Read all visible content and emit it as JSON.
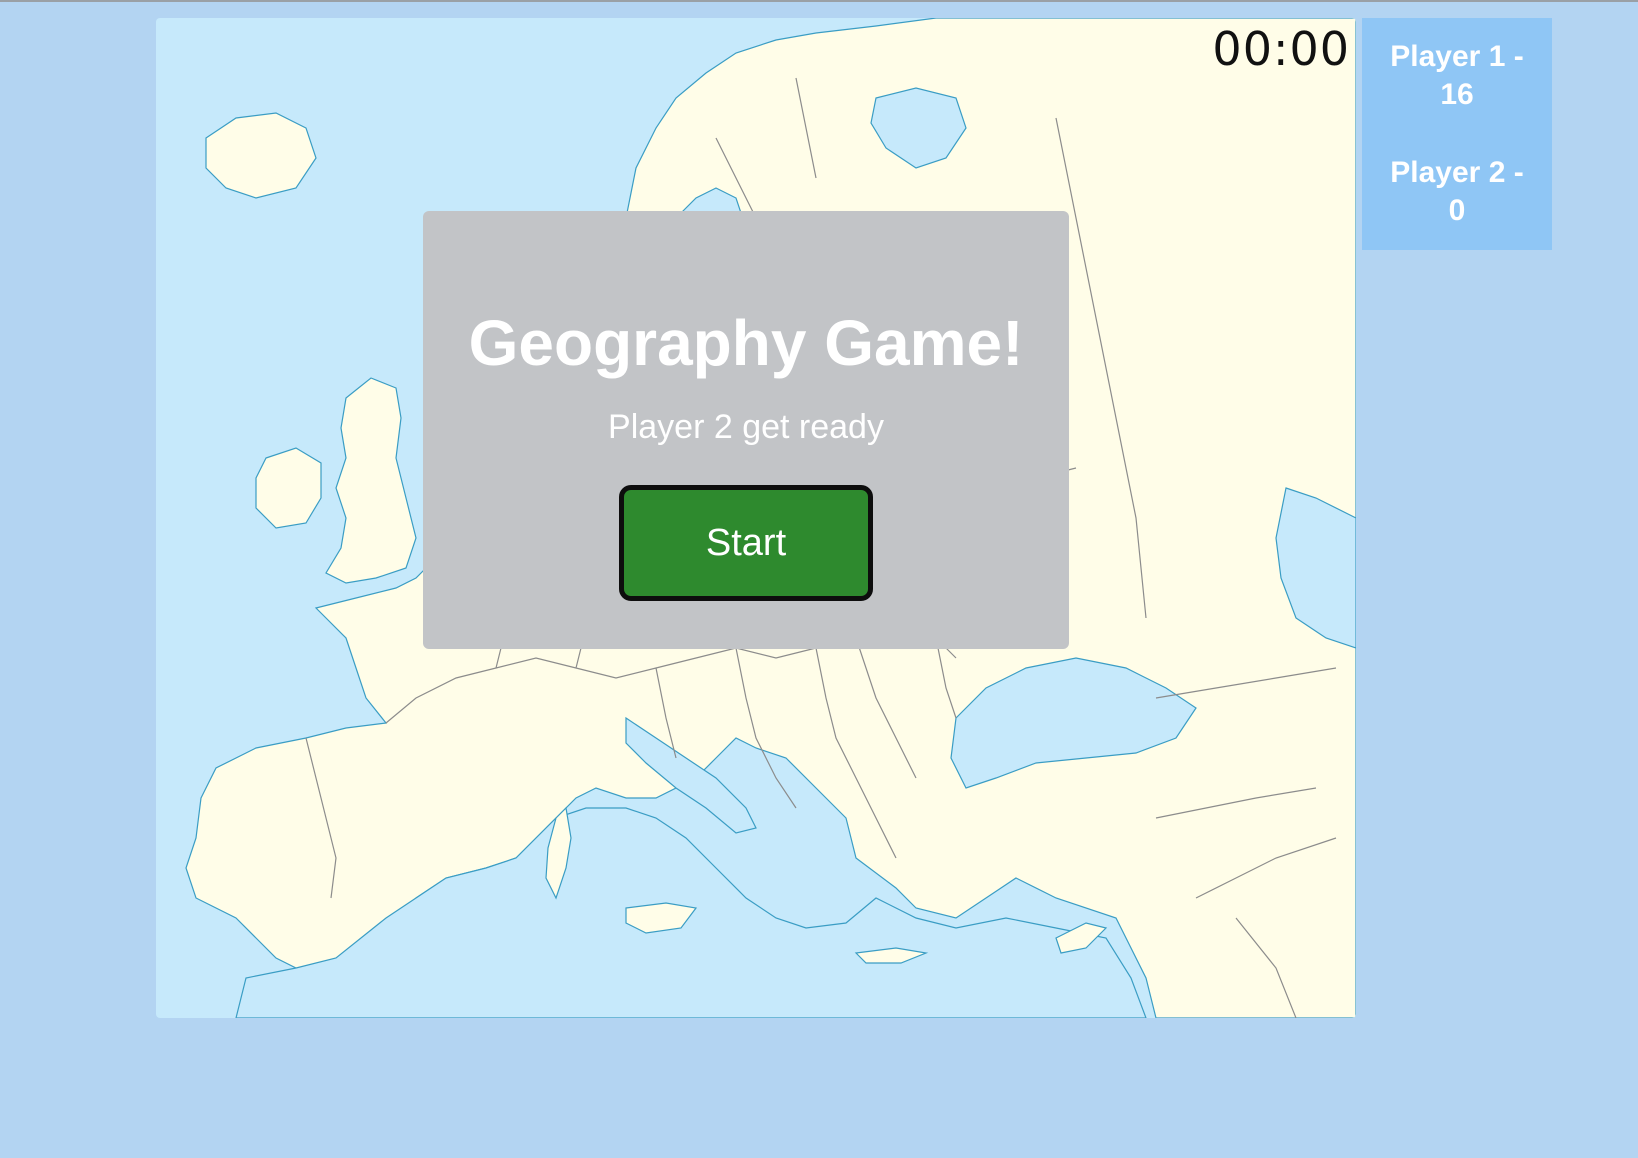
{
  "timer": {
    "display": "00:00"
  },
  "scoreboard": {
    "players": [
      {
        "line1": "Player 1 -",
        "line2": "16"
      },
      {
        "line1": "Player 2 -",
        "line2": "0"
      }
    ]
  },
  "modal": {
    "title": "Geography Game!",
    "subtitle": "Player 2 get ready",
    "start_label": "Start"
  },
  "colors": {
    "page_background": "#b3d4f2",
    "sea": "#c6e9fb",
    "land": "#fffde8",
    "modal_background": "#c2c4c7",
    "start_button": "#2e8a2e",
    "scoreboard": "#8fc6f5"
  }
}
